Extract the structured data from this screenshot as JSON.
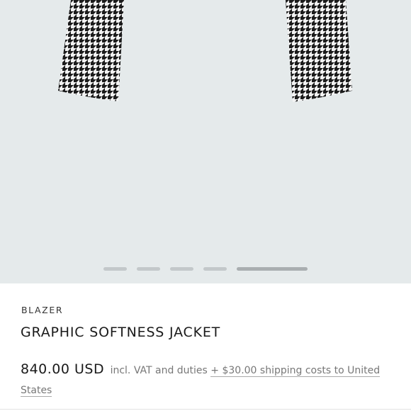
{
  "gallery": {
    "image_name": "houndstooth blazer sleeves",
    "slide_count": 5,
    "active_slide": 5,
    "background": "#e5eaeb"
  },
  "product": {
    "category": "BLAZER",
    "title": "GRAPHIC SOFTNESS JACKET",
    "price": "840.00 USD",
    "tax_note": "incl. VAT and duties",
    "shipping_text": "+ $30.00 shipping costs to United States"
  },
  "colors": {
    "text_primary": "#1a1a1a",
    "text_secondary": "#777777",
    "pattern_dark": "#1b1b1b",
    "pattern_light": "#f3f3f3"
  }
}
